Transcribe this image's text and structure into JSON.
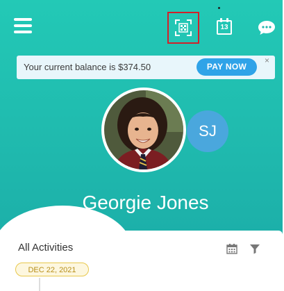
{
  "header": {
    "icons": [
      "menu-icon",
      "qr-scan-icon",
      "calendar-icon",
      "chat-icon"
    ],
    "calendar_day": "13",
    "highlight_color": "#d2202a"
  },
  "banner": {
    "text": "Your current balance is $374.50",
    "pay_label": "PAY NOW",
    "close_glyph": "×",
    "button_color": "#2fa3e8"
  },
  "profile": {
    "name": "Georgie Jones",
    "initials": "SJ",
    "initials_color": "#4aa7dd"
  },
  "activities": {
    "title": "All Activities",
    "date_chip": "DEC 22, 2021",
    "icons": [
      "calendar-icon",
      "filter-icon"
    ]
  },
  "theme": {
    "background_top": "#23c9b6",
    "background_bottom": "#1aa9a6"
  }
}
